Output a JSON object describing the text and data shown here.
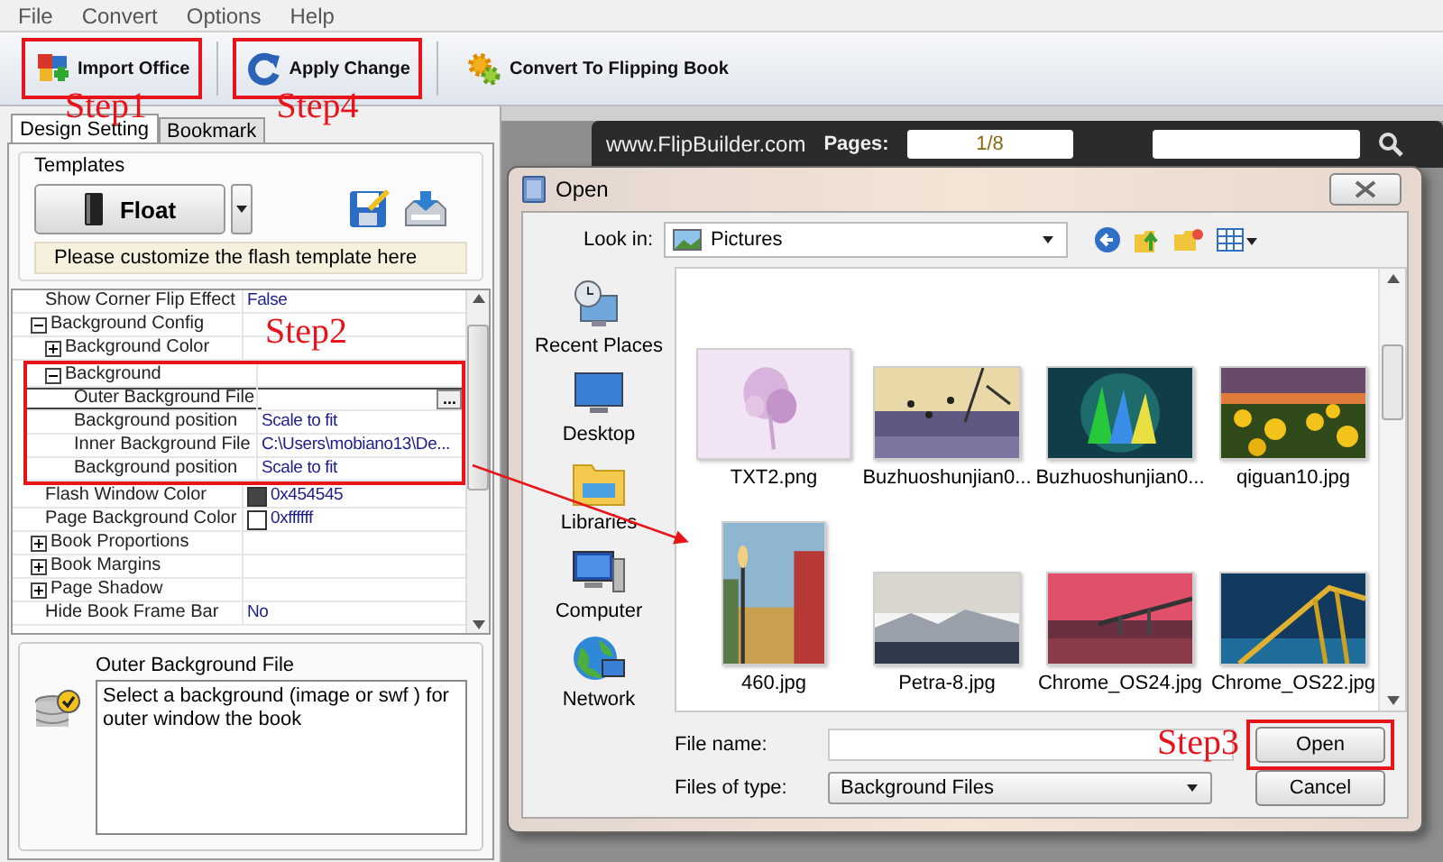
{
  "menu": [
    "File",
    "Convert",
    "Options",
    "Help"
  ],
  "toolbar": [
    {
      "label": "Import Office",
      "highlighted": true,
      "step": "Step1"
    },
    {
      "label": "Apply Change",
      "highlighted": true,
      "step": "Step4"
    },
    {
      "label": "Convert To Flipping Book",
      "highlighted": false
    }
  ],
  "left_panel": {
    "tabs": [
      {
        "label": "Design Setting",
        "selected": true
      },
      {
        "label": "Bookmark",
        "selected": false
      }
    ],
    "templates": {
      "label": "Templates",
      "template": "Float",
      "hint": "Please customize the flash template here"
    },
    "properties": [
      {
        "name": "Show Corner Flip Effect",
        "value": "False",
        "selected": false
      },
      {
        "name": "Background Config",
        "expanded": true,
        "selected": false,
        "children": [
          {
            "name": "Background Color",
            "expanded": false,
            "selected": false
          },
          {
            "name": "Background",
            "expanded": true,
            "selected": false,
            "highlighted": true,
            "step": "Step2",
            "children": [
              {
                "name": "Outer Background File",
                "selected": true,
                "button": "..."
              },
              {
                "name": "Background position",
                "value": "Scale to fit",
                "selected": false
              },
              {
                "name": "Inner Background File",
                "value": "C:\\Users\\mobiano13\\De...",
                "selected": false
              },
              {
                "name": "Background position",
                "value": "Scale to fit",
                "selected": false
              }
            ]
          }
        ]
      },
      {
        "name": "Flash Window Color",
        "value": "0x454545",
        "color": "#454545",
        "selected": false
      },
      {
        "name": "Page Background Color",
        "value": "0xffffff",
        "color": "#ffffff",
        "selected": false
      },
      {
        "name": "Book Proportions",
        "expanded": false,
        "selected": false
      },
      {
        "name": "Book Margins",
        "expanded": false,
        "selected": false
      },
      {
        "name": "Page Shadow",
        "expanded": false,
        "selected": false
      },
      {
        "name": "Hide Book Frame Bar",
        "value": "No",
        "selected": false
      }
    ],
    "description": {
      "title": "Outer Background File",
      "text": "Select a background (image or swf ) for outer window the book"
    }
  },
  "viewer": {
    "site": "www.FlipBuilder.com",
    "pages_label": "Pages:",
    "page": "1/8"
  },
  "dialog": {
    "title": "Open",
    "look_in_label": "Look in:",
    "look_in": "Pictures",
    "places": [
      {
        "label": "Recent Places"
      },
      {
        "label": "Desktop"
      },
      {
        "label": "Libraries"
      },
      {
        "label": "Computer"
      },
      {
        "label": "Network"
      }
    ],
    "files": [
      {
        "name": "TXT2.png"
      },
      {
        "name": "Buzhuoshunjian0..."
      },
      {
        "name": "Buzhuoshunjian0..."
      },
      {
        "name": "qiguan10.jpg"
      },
      {
        "name": "460.jpg"
      },
      {
        "name": "Petra-8.jpg"
      },
      {
        "name": "Chrome_OS24.jpg"
      },
      {
        "name": "Chrome_OS22.jpg"
      }
    ],
    "file_name_label": "File name:",
    "file_type_label": "Files of type:",
    "file_type": "Background Files",
    "buttons": [
      {
        "label": "Open",
        "highlighted": true,
        "step": "Step3"
      },
      {
        "label": "Cancel",
        "highlighted": false
      }
    ]
  }
}
